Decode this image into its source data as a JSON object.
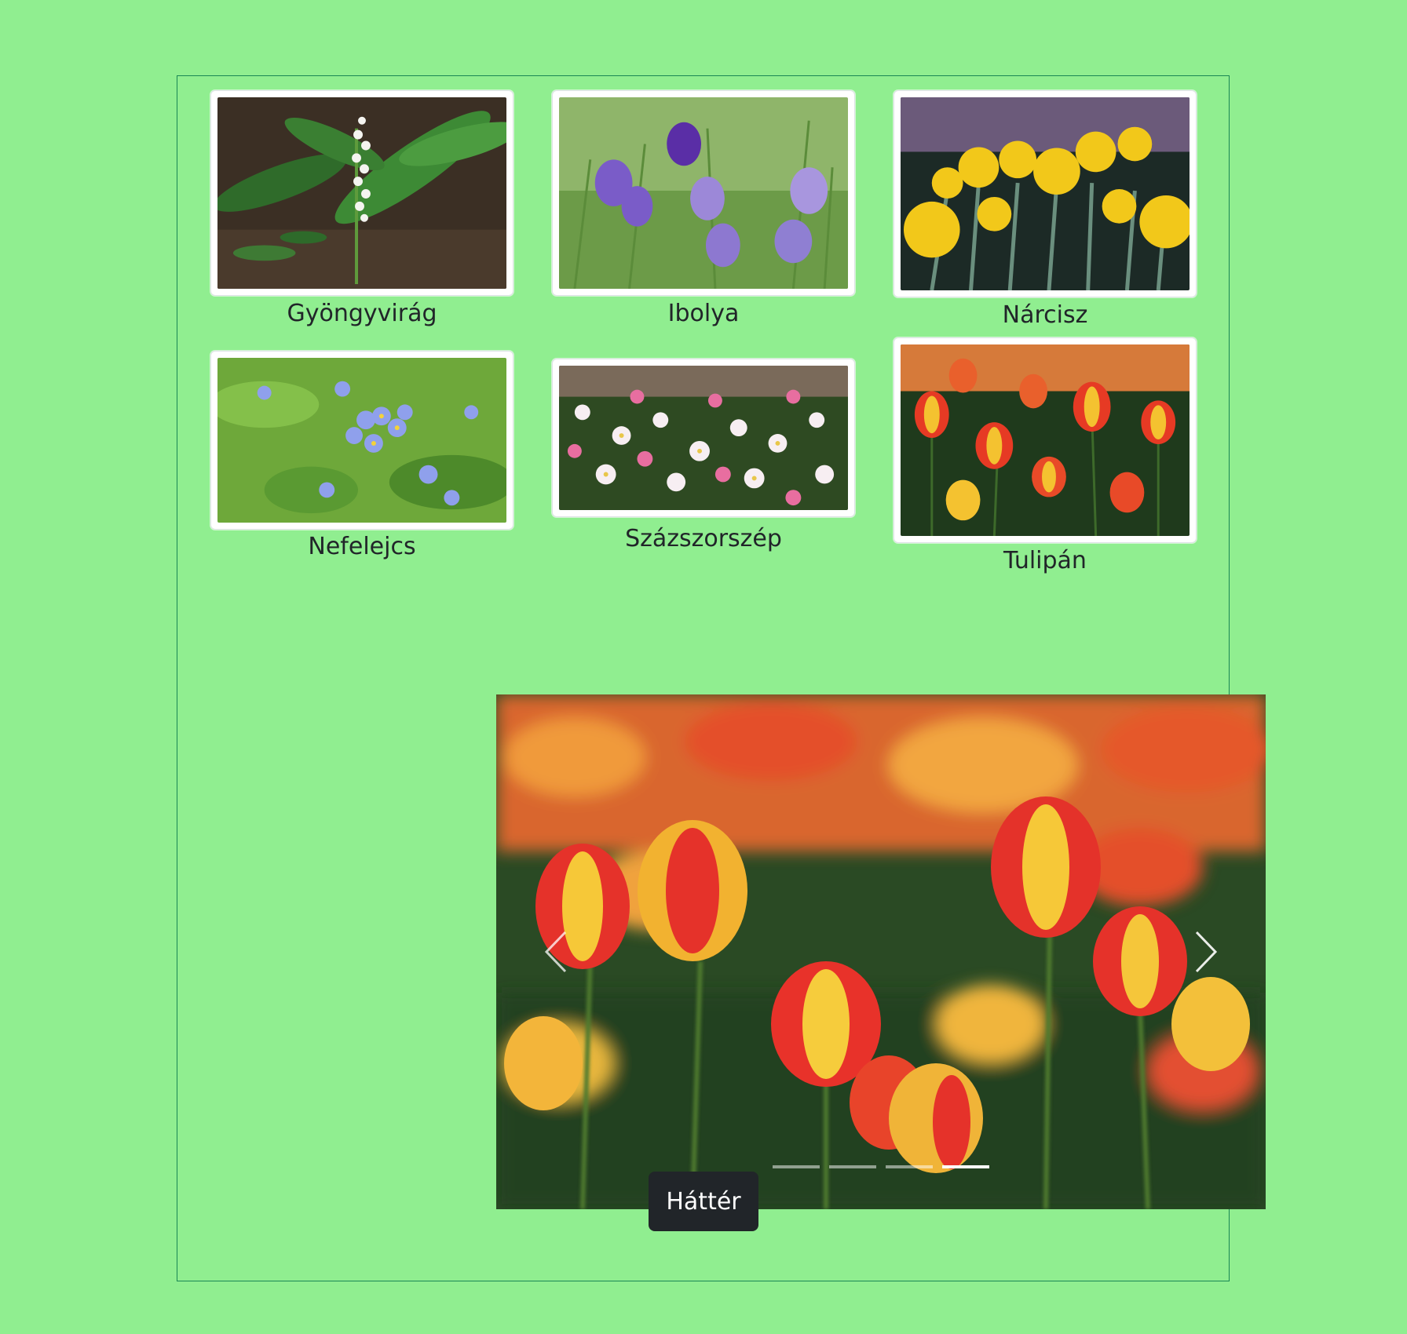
{
  "gallery": [
    {
      "caption": "Gyöngyvirág",
      "image_icon": "lily-of-the-valley-photo"
    },
    {
      "caption": "Ibolya",
      "image_icon": "violet-photo"
    },
    {
      "caption": "Nárcisz",
      "image_icon": "daffodil-photo"
    },
    {
      "caption": "Nefelejcs",
      "image_icon": "forget-me-not-photo"
    },
    {
      "caption": "Százszorszép",
      "image_icon": "daisy-photo"
    },
    {
      "caption": "Tulipán",
      "image_icon": "tulip-photo"
    }
  ],
  "carousel": {
    "current_image_icon": "tulip-photo",
    "slide_count": 4,
    "active_index": 3,
    "prev_icon": "chevron-left-icon",
    "next_icon": "chevron-right-icon"
  },
  "button": {
    "label": "Háttér"
  },
  "colors": {
    "page_background": "#90ee90",
    "container_border": "#198754",
    "button_background": "#212529",
    "button_text": "#ffffff"
  }
}
